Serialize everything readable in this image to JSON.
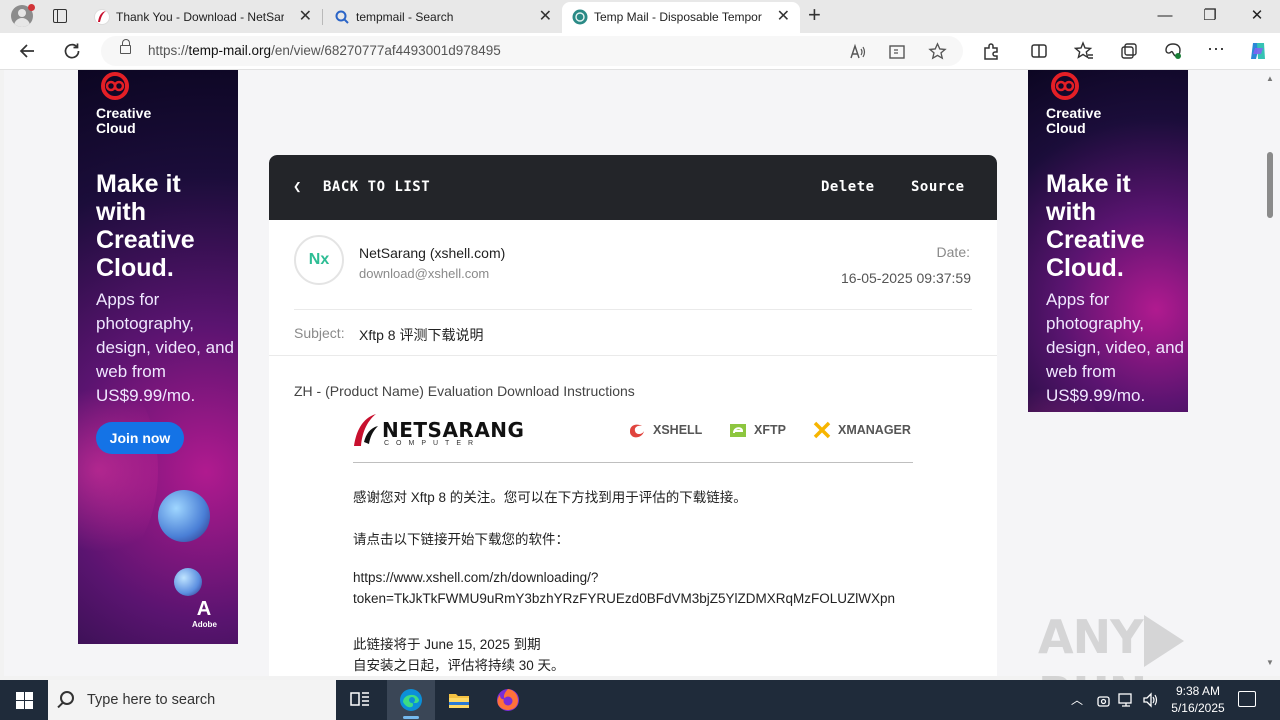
{
  "browser": {
    "tabs": [
      {
        "title": "Thank You - Download - NetSarang",
        "close": "✕"
      },
      {
        "title": "tempmail - Search",
        "close": "✕"
      },
      {
        "title": "Temp Mail - Disposable Temporary Email",
        "close": "✕"
      }
    ],
    "new_tab": "+",
    "window": {
      "minimize": "—",
      "restore": "❐",
      "close": "✕"
    },
    "url": {
      "scheme": "https://",
      "host": "temp-mail.org",
      "path": "/en/view/68270777af4493001d978495"
    },
    "toolbar_icons": [
      "back-arrow-icon",
      "refresh-icon",
      "read-aloud-icon",
      "immersive-reader-icon",
      "favorite-star-icon",
      "extensions-icon",
      "split-screen-icon",
      "favorites-icon",
      "collections-icon",
      "browser-essentials-icon",
      "more-icon",
      "copilot-icon"
    ]
  },
  "ad": {
    "brand": "Creative Cloud",
    "headline": "Make it with Creative Cloud.",
    "body": "Apps for photography, design, video, and web from US$9.99/mo.",
    "cta": "Join now",
    "maker": "Adobe",
    "maker_initial": "A"
  },
  "mail": {
    "back_label": "BACK TO LIST",
    "delete_label": "Delete",
    "source_label": "Source",
    "avatar_initials": "Nx",
    "from_name": "NetSarang (xshell.com)",
    "from_email": "download@xshell.com",
    "date_label": "Date:",
    "date_value": "16-05-2025 09:37:59",
    "subject_label": "Subject:",
    "subject_value": "Xftp 8 评测下载说明",
    "intro": "ZH - (Product Name) Evaluation Download Instructions",
    "logo_word": "NETSARANG",
    "logo_sub": "COMPUTER",
    "products": [
      "XSHELL",
      "XFTP",
      "XMANAGER"
    ],
    "paragraphs": [
      "感谢您对 Xftp 8 的关注。您可以在下方找到用于评估的下载链接。",
      "请点击以下链接开始下载您的软件：",
      "https://www.xshell.com/zh/downloading/?",
      "token=TkJkTkFWMU9uRmY3bzhYRzFYRUEzd0BFdVM3bjZ5YlZDMXRqMzFOLUZlWXpn",
      "此链接将于 June 15, 2025 到期",
      "自安装之日起，评估将持续 30 天。"
    ]
  },
  "watermark": {
    "left": "ANY",
    "right": "RUN"
  },
  "taskbar": {
    "search_placeholder": "Type here to search",
    "apps": [
      "task-view-icon",
      "edge-icon",
      "file-explorer-icon",
      "firefox-icon"
    ],
    "time": "9:38 AM",
    "date": "5/16/2025"
  },
  "colors": {
    "accent": "#2dbd94",
    "mailbar": "#232529",
    "taskbar": "#1f2b3a",
    "adobe_button": "#1473e6"
  }
}
